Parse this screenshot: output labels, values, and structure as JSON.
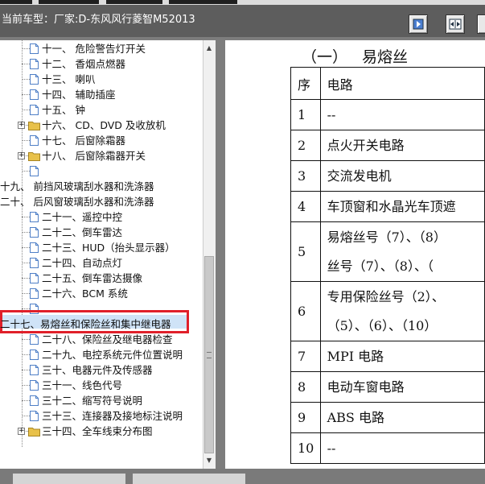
{
  "header": {
    "vehicle_info": "当前车型：厂家:D-东风风行菱智M52013"
  },
  "tree": {
    "items": [
      {
        "label": "十一、 危险警告灯开关",
        "type": "doc",
        "level": 2
      },
      {
        "label": "十二、 香烟点燃器",
        "type": "doc",
        "level": 2
      },
      {
        "label": "十三、 喇叭",
        "type": "doc",
        "level": 2
      },
      {
        "label": "十四、 辅助插座",
        "type": "doc",
        "level": 2
      },
      {
        "label": "十五、 钟",
        "type": "doc",
        "level": 2
      },
      {
        "label": "十六、 CD、DVD 及收放机",
        "type": "folder",
        "level": 2
      },
      {
        "label": "十七、 后窗除霜器",
        "type": "doc",
        "level": 2
      },
      {
        "label": "十八、 后窗除霜器开关",
        "type": "folder",
        "level": 2
      },
      {
        "label": "",
        "type": "doc",
        "level": 2
      },
      {
        "label": "十九、 前挡风玻璃刮水器和洗涤器",
        "type": "text",
        "level": 0
      },
      {
        "label": "二十、 后风窗玻璃刮水器和洗涤器",
        "type": "text",
        "level": 0
      },
      {
        "label": "二十一、遥控中控",
        "type": "doc",
        "level": 2
      },
      {
        "label": "二十二、倒车雷达",
        "type": "doc",
        "level": 2
      },
      {
        "label": "二十三、HUD（抬头显示器）",
        "type": "doc",
        "level": 2
      },
      {
        "label": "二十四、自动点灯",
        "type": "doc",
        "level": 2
      },
      {
        "label": "二十五、倒车雷达摄像",
        "type": "doc",
        "level": 2
      },
      {
        "label": "二十六、BCM 系统",
        "type": "doc",
        "level": 2
      },
      {
        "label": "",
        "type": "doc",
        "level": 2
      },
      {
        "label": "二十七、易熔丝和保险丝和集中继电器",
        "type": "text",
        "level": 0
      },
      {
        "label": "二十八、保险丝及继电器检查",
        "type": "doc",
        "level": 2
      },
      {
        "label": "二十九、电控系统元件位置说明",
        "type": "doc",
        "level": 2
      },
      {
        "label": "三十、电器元件及传感器",
        "type": "doc",
        "level": 2
      },
      {
        "label": "三十一、线色代号",
        "type": "doc",
        "level": 2
      },
      {
        "label": "三十二、缩写符号说明",
        "type": "doc",
        "level": 2
      },
      {
        "label": "三十三、连接器及接地标注说明",
        "type": "doc",
        "level": 2
      },
      {
        "label": "三十四、全车线束分布图",
        "type": "folder",
        "level": 2
      }
    ]
  },
  "document": {
    "section_number": "（一）",
    "section_title": "易熔丝",
    "table": {
      "headers": [
        "序",
        "电路"
      ],
      "rows": [
        {
          "no": "1",
          "circuit": "--"
        },
        {
          "no": "2",
          "circuit": "点火开关电路"
        },
        {
          "no": "3",
          "circuit": "交流发电机"
        },
        {
          "no": "4",
          "circuit": "车顶窗和水晶光车顶遮"
        },
        {
          "no": "5",
          "circuit": "易熔丝号（7）、（8）",
          "circuit2": "丝号（7）、（8）、（"
        },
        {
          "no": "6",
          "circuit": "专用保险丝号（2）、",
          "circuit2": "（5）、（6）、（10）"
        },
        {
          "no": "7",
          "circuit": "MPI 电路"
        },
        {
          "no": "8",
          "circuit": "电动车窗电路"
        },
        {
          "no": "9",
          "circuit": "ABS 电路"
        },
        {
          "no": "10",
          "circuit": "--"
        }
      ]
    }
  },
  "colors": {
    "header_bg": "#5d5d5d",
    "selection_border": "#e0202a",
    "selection_fill": "#cfe3f7",
    "folder_yellow": "#e8c14a",
    "doc_blue": "#4f7fc6"
  }
}
